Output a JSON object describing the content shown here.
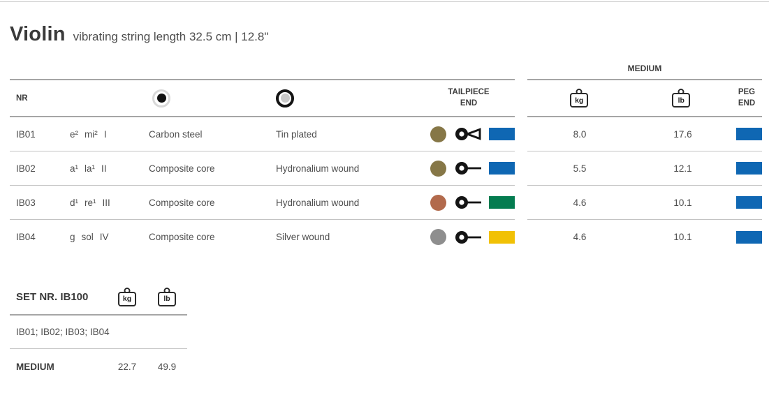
{
  "page": {
    "title": "Violin",
    "subtitle": "vibrating string length 32.5 cm | 12.8\""
  },
  "icons": {
    "kg_label": "kg",
    "lb_label": "lb"
  },
  "main_table": {
    "headers": {
      "nr": "NR",
      "tailpiece_end": "TAILPIECE END"
    },
    "rows": [
      {
        "nr": "IB01",
        "pitch": "e²",
        "solfege": "mi²",
        "position": "I",
        "core": "Carbon steel",
        "winding": "Tin plated",
        "dot_color": "#867747",
        "end_type": "end-loop",
        "tailpiece_color": "#0f67b3",
        "kg": "8.0",
        "lb": "17.6",
        "peg_color": "#0f67b3"
      },
      {
        "nr": "IB02",
        "pitch": "a¹",
        "solfege": "la¹",
        "position": "II",
        "core": "Composite core",
        "winding": "Hydronalium wound",
        "dot_color": "#867747",
        "end_type": "end-line",
        "tailpiece_color": "#0f67b3",
        "kg": "5.5",
        "lb": "12.1",
        "peg_color": "#0f67b3"
      },
      {
        "nr": "IB03",
        "pitch": "d¹",
        "solfege": "re¹",
        "position": "III",
        "core": "Composite core",
        "winding": "Hydronalium wound",
        "dot_color": "#b26a4c",
        "end_type": "end-line",
        "tailpiece_color": "#047c50",
        "kg": "4.6",
        "lb": "10.1",
        "peg_color": "#0f67b3"
      },
      {
        "nr": "IB04",
        "pitch": "g",
        "solfege": "sol",
        "position": "IV",
        "core": "Composite core",
        "winding": "Silver wound",
        "dot_color": "#8e8e8e",
        "end_type": "end-line",
        "tailpiece_color": "#f1c105",
        "kg": "4.6",
        "lb": "10.1",
        "peg_color": "#0f67b3"
      }
    ]
  },
  "tension_table": {
    "group_label": "MEDIUM",
    "peg_end": "PEG END"
  },
  "set_table": {
    "title": "SET NR. IB100",
    "contents": "IB01; IB02; IB03; IB04",
    "row_label": "MEDIUM",
    "kg": "22.7",
    "lb": "49.9"
  }
}
